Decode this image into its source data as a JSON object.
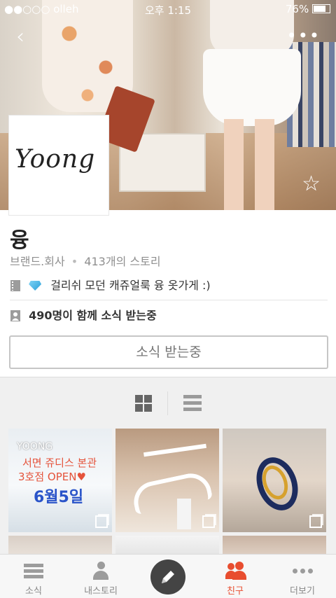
{
  "status_bar": {
    "carrier": "●●○○○ olleh",
    "time": "오후 1:15",
    "battery": "76%"
  },
  "profile": {
    "logo_text": "Yoong",
    "name": "융",
    "category": "브랜드.회사",
    "story_count": "413개의 스토리",
    "description": "걸리쉬 모던 캐쥬얼룩 융 옷가게 :)",
    "followers": "490명이 함께 소식 받는중",
    "follow_button": "소식 받는중"
  },
  "photo_tile_1": {
    "line1": "YOONG",
    "line2": "서면 쥬디스 본관",
    "line3": "3호점 OPEN♥",
    "line4": "6월5일"
  },
  "tabbar": {
    "tabs": [
      {
        "label": "소식",
        "icon": "news-icon"
      },
      {
        "label": "내스토리",
        "icon": "person-icon"
      },
      {
        "label": "",
        "icon": "pencil-icon"
      },
      {
        "label": "친구",
        "icon": "friends-icon"
      },
      {
        "label": "더보기",
        "icon": "more-dots-icon"
      }
    ],
    "active_color": "#e84d2f"
  }
}
